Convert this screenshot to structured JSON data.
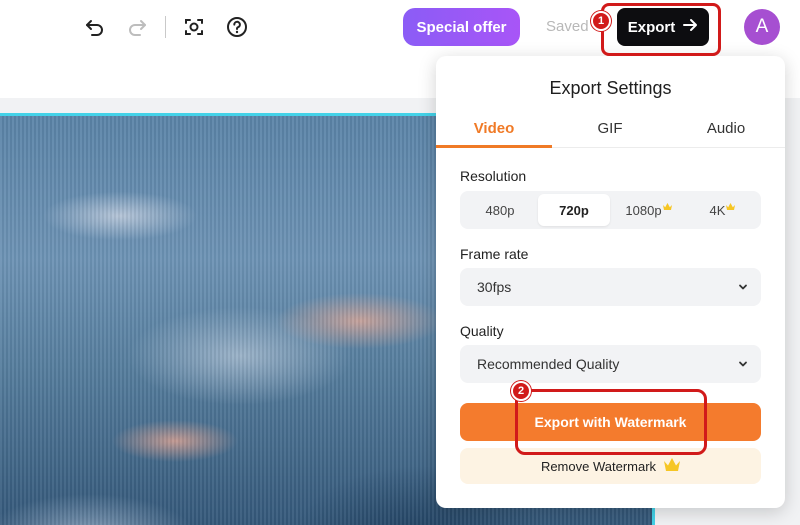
{
  "toolbar": {
    "icons": [
      "undo-icon",
      "redo-icon",
      "screen-capture-icon",
      "help-icon"
    ],
    "special_offer_label": "Special offer",
    "saved_label": "Saved",
    "export_label": "Export",
    "avatar_initial": "A"
  },
  "callouts": [
    "1",
    "2"
  ],
  "export_panel": {
    "title": "Export Settings",
    "tabs": [
      "Video",
      "GIF",
      "Audio"
    ],
    "active_tab": "Video",
    "resolution": {
      "label": "Resolution",
      "options": [
        "480p",
        "720p",
        "1080p",
        "4K"
      ],
      "selected": "720p"
    },
    "frame_rate": {
      "label": "Frame rate",
      "value": "30fps"
    },
    "quality": {
      "label": "Quality",
      "value": "Recommended Quality"
    },
    "export_watermark_label": "Export with Watermark",
    "remove_watermark_label": "Remove Watermark"
  },
  "colors": {
    "accent": "#f47b2d",
    "offer": "#a855f7",
    "callout": "#d11a1a",
    "selection": "#43d2e8"
  }
}
